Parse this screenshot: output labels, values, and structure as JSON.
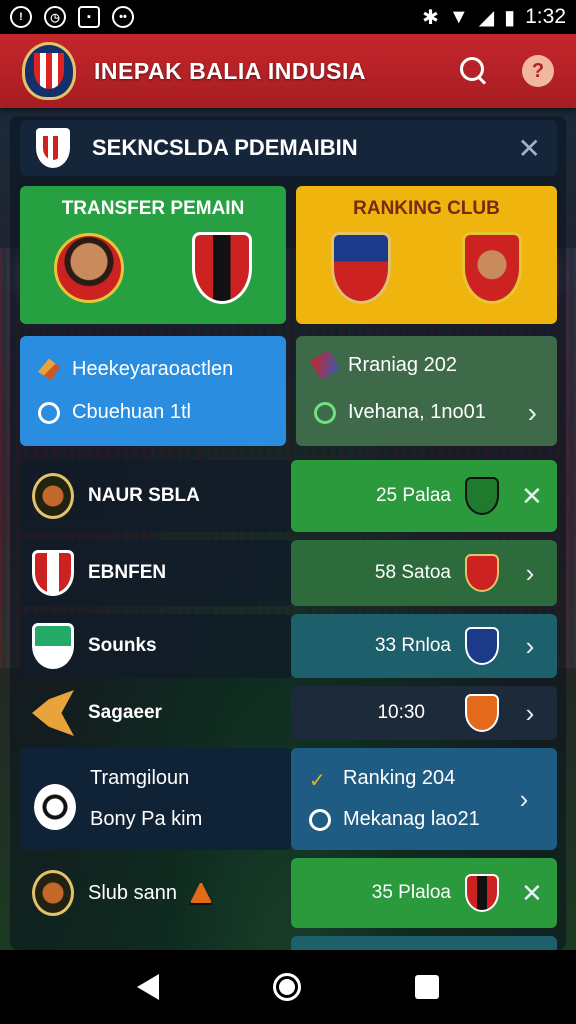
{
  "status_bar": {
    "time": "1:32"
  },
  "app": {
    "title": "INEPAK BALIA INDUSIA"
  },
  "panel": {
    "title": "SEKNCSLDA PDEMAIBIN"
  },
  "cards": {
    "transfer_title": "TRANSFER PEMAIN",
    "ranking_title": "RANKING CLUB"
  },
  "info_left": {
    "line1": "Heekeyaraoactlen",
    "line2": "Cbuehuan 1tl"
  },
  "info_right": {
    "line1": "Rraniag 202",
    "line2": "Ivehana, 1no01"
  },
  "rows": [
    {
      "name": "NAUR SBLA",
      "value": "25 Palaa",
      "action": "✕"
    },
    {
      "name": "EBNFEN",
      "value": "58 Satoa",
      "action": "›"
    },
    {
      "name": "Sounks",
      "value": "33 Rnloa",
      "action": "›"
    },
    {
      "name": "Sagaeer",
      "value": "10:30",
      "action": "›"
    },
    {
      "name": "Slub sann",
      "value": "35 Plaloa",
      "action": "✕"
    }
  ],
  "combo_row": {
    "left_line1": "Tramgiloun",
    "left_line2": "Bony Pa kim",
    "right_line1": "Ranking 204",
    "right_line2": "Mekanag lao21",
    "action": "›"
  },
  "icons": {
    "search": "search-icon",
    "help": "help-icon",
    "close": "close-icon",
    "chevron": "chevron-right-icon"
  },
  "colors": {
    "header_red": "#c4262b",
    "card_green": "#27a041",
    "card_yellow": "#efb40e",
    "info_blue": "#2a8de0"
  }
}
